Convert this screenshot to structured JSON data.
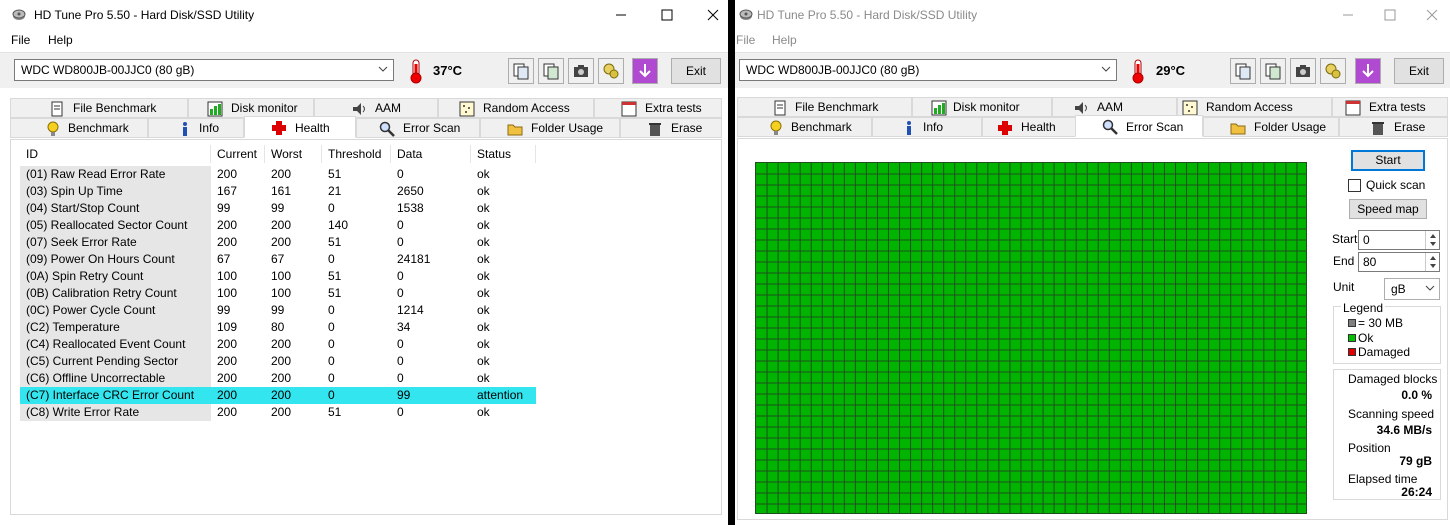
{
  "left": {
    "title": "HD Tune Pro 5.50 - Hard Disk/SSD Utility",
    "menu": [
      "File",
      "Help"
    ],
    "drive": "WDC WD800JB-00JJC0 (80 gB)",
    "temperature": "37°C",
    "exit_label": "Exit",
    "tabs_top": [
      "File Benchmark",
      "Disk monitor",
      "AAM",
      "Random Access",
      "Extra tests"
    ],
    "tabs_bottom": [
      "Benchmark",
      "Info",
      "Health",
      "Error Scan",
      "Folder Usage",
      "Erase"
    ],
    "active_tab": "Health",
    "health": {
      "columns": [
        "ID",
        "Current",
        "Worst",
        "Threshold",
        "Data",
        "Status"
      ],
      "rows": [
        {
          "id": "(01) Raw Read Error Rate",
          "current": "200",
          "worst": "200",
          "threshold": "51",
          "data": "0",
          "status": "ok"
        },
        {
          "id": "(03) Spin Up Time",
          "current": "167",
          "worst": "161",
          "threshold": "21",
          "data": "2650",
          "status": "ok"
        },
        {
          "id": "(04) Start/Stop Count",
          "current": "99",
          "worst": "99",
          "threshold": "0",
          "data": "1538",
          "status": "ok"
        },
        {
          "id": "(05) Reallocated Sector Count",
          "current": "200",
          "worst": "200",
          "threshold": "140",
          "data": "0",
          "status": "ok"
        },
        {
          "id": "(07) Seek Error Rate",
          "current": "200",
          "worst": "200",
          "threshold": "51",
          "data": "0",
          "status": "ok"
        },
        {
          "id": "(09) Power On Hours Count",
          "current": "67",
          "worst": "67",
          "threshold": "0",
          "data": "24181",
          "status": "ok"
        },
        {
          "id": "(0A) Spin Retry Count",
          "current": "100",
          "worst": "100",
          "threshold": "51",
          "data": "0",
          "status": "ok"
        },
        {
          "id": "(0B) Calibration Retry Count",
          "current": "100",
          "worst": "100",
          "threshold": "51",
          "data": "0",
          "status": "ok"
        },
        {
          "id": "(0C) Power Cycle Count",
          "current": "99",
          "worst": "99",
          "threshold": "0",
          "data": "1214",
          "status": "ok"
        },
        {
          "id": "(C2) Temperature",
          "current": "109",
          "worst": "80",
          "threshold": "0",
          "data": "34",
          "status": "ok"
        },
        {
          "id": "(C4) Reallocated Event Count",
          "current": "200",
          "worst": "200",
          "threshold": "0",
          "data": "0",
          "status": "ok"
        },
        {
          "id": "(C5) Current Pending Sector",
          "current": "200",
          "worst": "200",
          "threshold": "0",
          "data": "0",
          "status": "ok"
        },
        {
          "id": "(C6) Offline Uncorrectable",
          "current": "200",
          "worst": "200",
          "threshold": "0",
          "data": "0",
          "status": "ok"
        },
        {
          "id": "(C7) Interface CRC Error Count",
          "current": "200",
          "worst": "200",
          "threshold": "0",
          "data": "99",
          "status": "attention"
        },
        {
          "id": "(C8) Write Error Rate",
          "current": "200",
          "worst": "200",
          "threshold": "51",
          "data": "0",
          "status": "ok"
        }
      ]
    }
  },
  "right": {
    "title": "HD Tune Pro 5.50 - Hard Disk/SSD Utility",
    "menu": [
      "File",
      "Help"
    ],
    "drive": "WDC WD800JB-00JJC0 (80 gB)",
    "temperature": "29°C",
    "exit_label": "Exit",
    "tabs_top": [
      "File Benchmark",
      "Disk monitor",
      "AAM",
      "Random Access",
      "Extra tests"
    ],
    "tabs_bottom": [
      "Benchmark",
      "Info",
      "Health",
      "Error Scan",
      "Folder Usage",
      "Erase"
    ],
    "active_tab": "Error Scan",
    "scan": {
      "start_button": "Start",
      "quick_scan_label": "Quick scan",
      "quick_scan_checked": false,
      "speed_map_button": "Speed map",
      "start_label": "Start",
      "start_value": "0",
      "end_label": "End",
      "end_value": "80",
      "unit_label": "Unit",
      "unit_value": "gB",
      "legend_title": "Legend",
      "legend": [
        {
          "label": "= 30 MB",
          "color": "#808080"
        },
        {
          "label": "Ok",
          "color": "#00c000"
        },
        {
          "label": "Damaged",
          "color": "#e00000"
        }
      ],
      "stats": [
        {
          "label": "Damaged blocks",
          "value": "0.0 %"
        },
        {
          "label": "Scanning speed",
          "value": "34.6 MB/s"
        },
        {
          "label": "Position",
          "value": "79 gB"
        },
        {
          "label": "Elapsed time",
          "value": "26:24"
        }
      ],
      "block_color": "#00b400",
      "grid_line_color": "#1f4f1f"
    }
  }
}
